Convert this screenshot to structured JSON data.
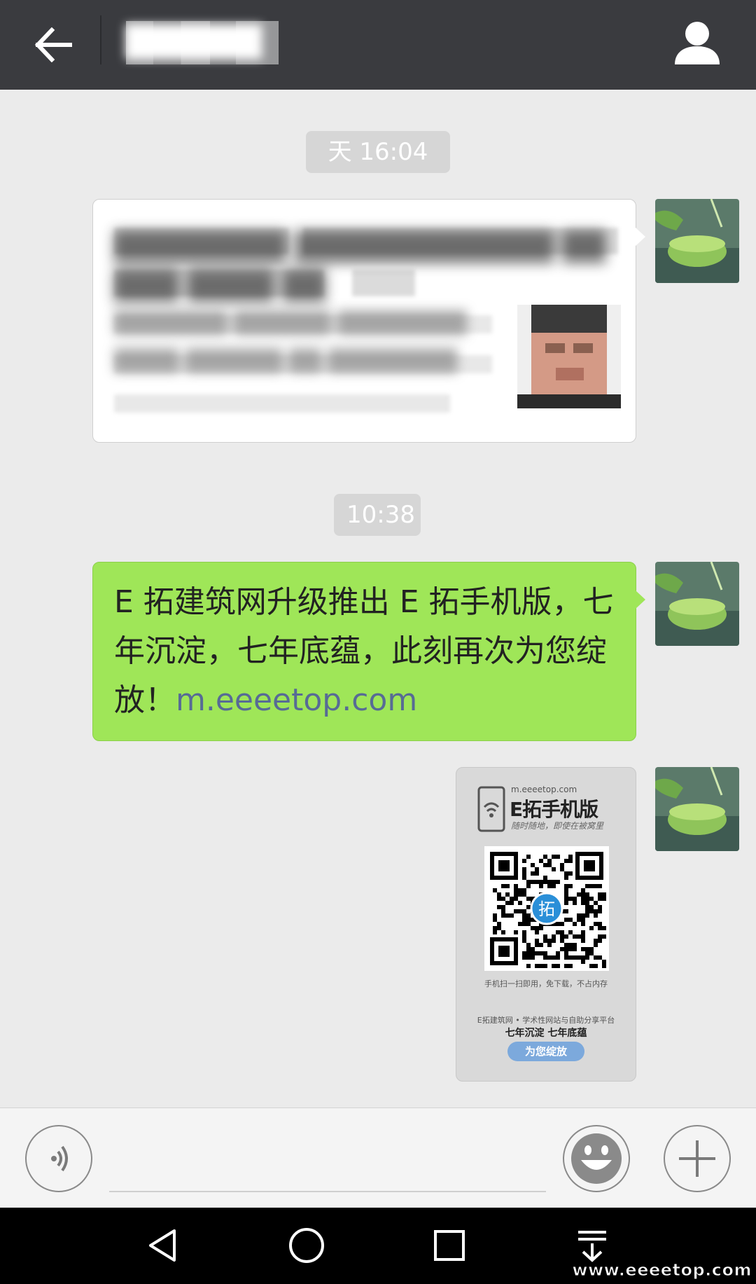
{
  "header": {
    "title": "██████",
    "back_icon": "arrow-left-icon",
    "contact_icon": "person-icon"
  },
  "timestamps": [
    "天 16:04",
    "10:38"
  ],
  "messages": [
    {
      "type": "link-card",
      "title": "████████ ████████████ ██ ███ ████ ██",
      "description": "███████ ██████ ████████ ████ ██████ ██ ████████"
    },
    {
      "type": "text",
      "text": "E 拓建筑网升级推出 E 拓手机版，七年沉淀，七年底蕴，此刻再次为您绽放！",
      "link": "m.eeeetop.com"
    },
    {
      "type": "image",
      "url": "m.eeeetop.com",
      "brand": "E拓手机版",
      "slogan": "随时随地，即使在被窝里",
      "qr_center": "拓",
      "caption1": "手机扫一扫即用，免下载，不占内存",
      "caption2": "E拓建筑网 • 学术性网站与自助分享平台",
      "caption3": "七年沉淀  七年底蕴",
      "pill": "为您绽放"
    }
  ],
  "input": {
    "placeholder": "",
    "voice_icon": "voice-icon",
    "emoji_icon": "emoji-icon",
    "plus_icon": "plus-icon"
  },
  "navbar": {
    "icons": [
      "back-triangle-icon",
      "home-circle-icon",
      "recents-square-icon",
      "notifications-down-icon"
    ]
  },
  "watermark": "www.eeeetop.com",
  "colors": {
    "topbar": "#3a3b3f",
    "background": "#ebebeb",
    "sent_bubble": "#9fe658",
    "link": "#576b95"
  }
}
